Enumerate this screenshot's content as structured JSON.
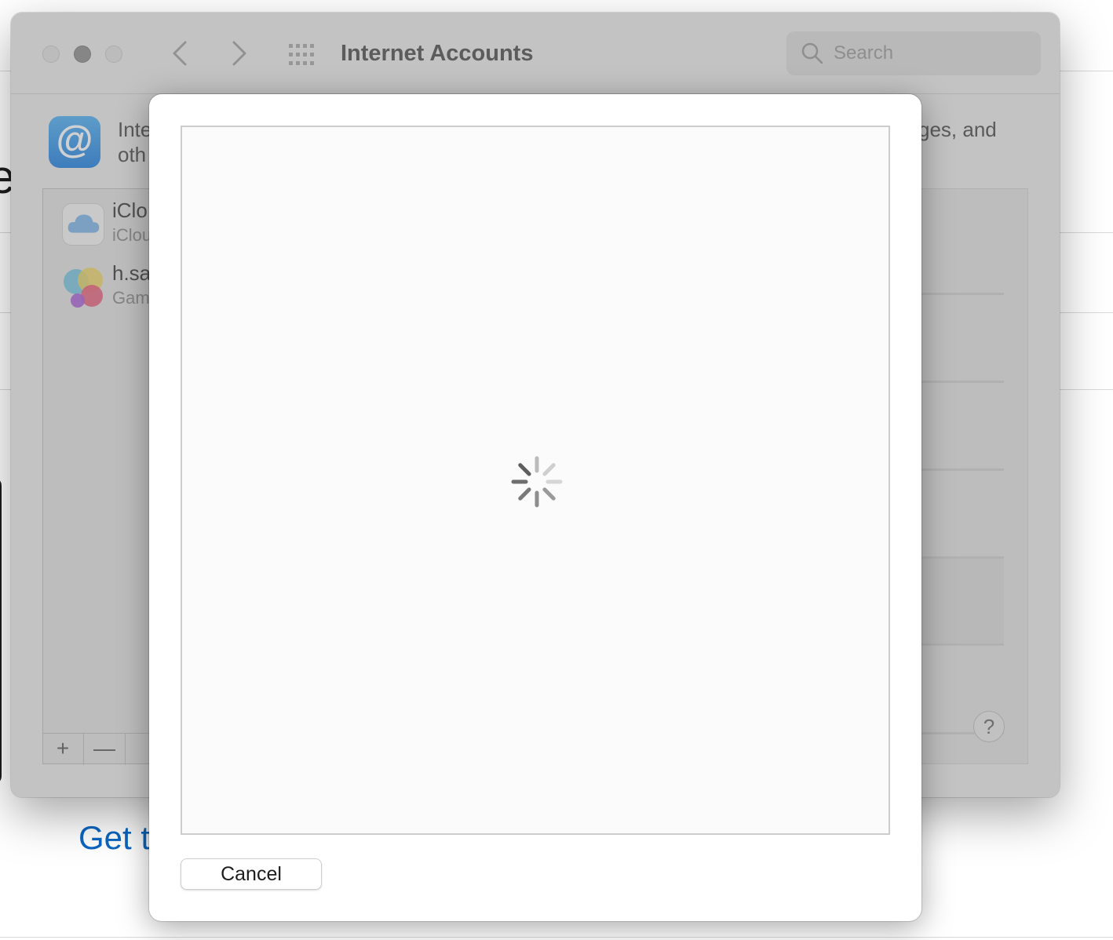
{
  "background_page": {
    "heading_fragment": "e",
    "link_fragment": "Get t"
  },
  "window": {
    "title": "Internet Accounts",
    "search": {
      "placeholder": "Search",
      "value": ""
    },
    "icons": {
      "back": "chevron-left-icon",
      "forward": "chevron-right-icon",
      "grid": "grid-icon",
      "search": "magnifier-icon",
      "pane": "at-sign-icon"
    },
    "pane_icon_glyph": "@",
    "description": {
      "line1_fragment": "Inte",
      "line2_fragment": "oth",
      "right_fragment": "ges, and"
    },
    "accounts": [
      {
        "name": "iClo",
        "subtitle": "iClou",
        "icon": "icloud-icon"
      },
      {
        "name": "h.sa",
        "subtitle": "Gam",
        "icon": "game-center-icon"
      }
    ],
    "list_toolbar": {
      "add_label": "+",
      "remove_label": "—"
    },
    "help_label": "?"
  },
  "sheet": {
    "loading": true,
    "cancel_label": "Cancel"
  },
  "colors": {
    "accent_link": "#0a66c2",
    "sheet_bg": "#ffffff",
    "window_bg": "#ececec"
  }
}
